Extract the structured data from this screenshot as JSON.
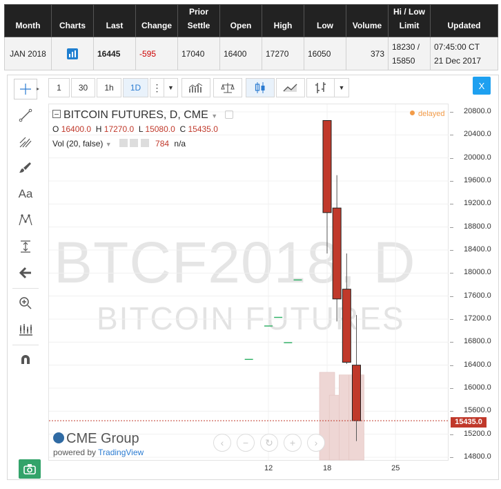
{
  "quote": {
    "headers": [
      "Month",
      "Charts",
      "Last",
      "Change",
      "Prior Settle",
      "Open",
      "High",
      "Low",
      "Volume",
      "Hi / Low Limit",
      "Updated"
    ],
    "row": {
      "month": "JAN 2018",
      "last": "16445",
      "change": "-595",
      "prior_settle": "17040",
      "open": "16400",
      "high": "17270",
      "low": "16050",
      "volume": "373",
      "limit_hi": "18230 /",
      "limit_lo": "15850",
      "updated_time": "07:45:00 CT",
      "updated_date": "21 Dec 2017"
    }
  },
  "toolbar": {
    "intervals": [
      "1",
      "30",
      "1h",
      "1D"
    ],
    "selected_interval": "1D",
    "close_label": "X"
  },
  "legend": {
    "title": "BITCOIN FUTURES, D, CME",
    "o_label": "O",
    "o_value": "16400.0",
    "h_label": "H",
    "h_value": "17270.0",
    "l_label": "L",
    "l_value": "15080.0",
    "c_label": "C",
    "c_value": "15435.0",
    "vol_label": "Vol (20, false)",
    "vol_value": "784",
    "vol_na": "n/a"
  },
  "status": {
    "delayed": "delayed"
  },
  "watermark": {
    "symbol": "BTCF2018, D",
    "name": "BITCOIN FUTURES"
  },
  "branding": {
    "logo": "CME Group",
    "powered_prefix": "powered by ",
    "powered_link": "TradingView"
  },
  "colors": {
    "bear": "#c0392b",
    "dash": "#27ae60",
    "volume": "#eed6d4",
    "accent": "#1ea0f0"
  },
  "chart_data": {
    "type": "candlestick",
    "y_axis": {
      "ticks": [
        20800,
        20400,
        20000,
        19600,
        19200,
        18800,
        18400,
        18000,
        17600,
        17200,
        16800,
        16400,
        16000,
        15600,
        15200,
        14800
      ],
      "min": 14700,
      "max": 20950
    },
    "x_axis": {
      "ticks": [
        "12",
        "18",
        "25"
      ]
    },
    "last_price": "15435.0",
    "candles": [
      {
        "day": 10,
        "open": 16500,
        "high": 16500,
        "low": 16500,
        "close": 16500
      },
      {
        "day": 12,
        "open": 17080,
        "high": 17080,
        "low": 17080,
        "close": 17080
      },
      {
        "day": 13,
        "open": 17230,
        "high": 17230,
        "low": 17230,
        "close": 17230
      },
      {
        "day": 14,
        "open": 16790,
        "high": 16790,
        "low": 16790,
        "close": 16790
      },
      {
        "day": 15,
        "open": 17880,
        "high": 17880,
        "low": 17880,
        "close": 17880
      },
      {
        "day": 18,
        "open": 20650,
        "high": 20650,
        "low": 18340,
        "close": 19050
      },
      {
        "day": 19,
        "open": 19130,
        "high": 19700,
        "low": 17160,
        "close": 17550
      },
      {
        "day": 20,
        "open": 17720,
        "high": 18340,
        "low": 16420,
        "close": 16450
      },
      {
        "day": 21,
        "open": 16400,
        "high": 17270,
        "low": 15080,
        "close": 15435
      }
    ],
    "volume": [
      {
        "day": 18,
        "value": 1515
      },
      {
        "day": 19,
        "value": 1120
      },
      {
        "day": 20,
        "value": 1470
      },
      {
        "day": 21,
        "value": 1470
      }
    ]
  }
}
